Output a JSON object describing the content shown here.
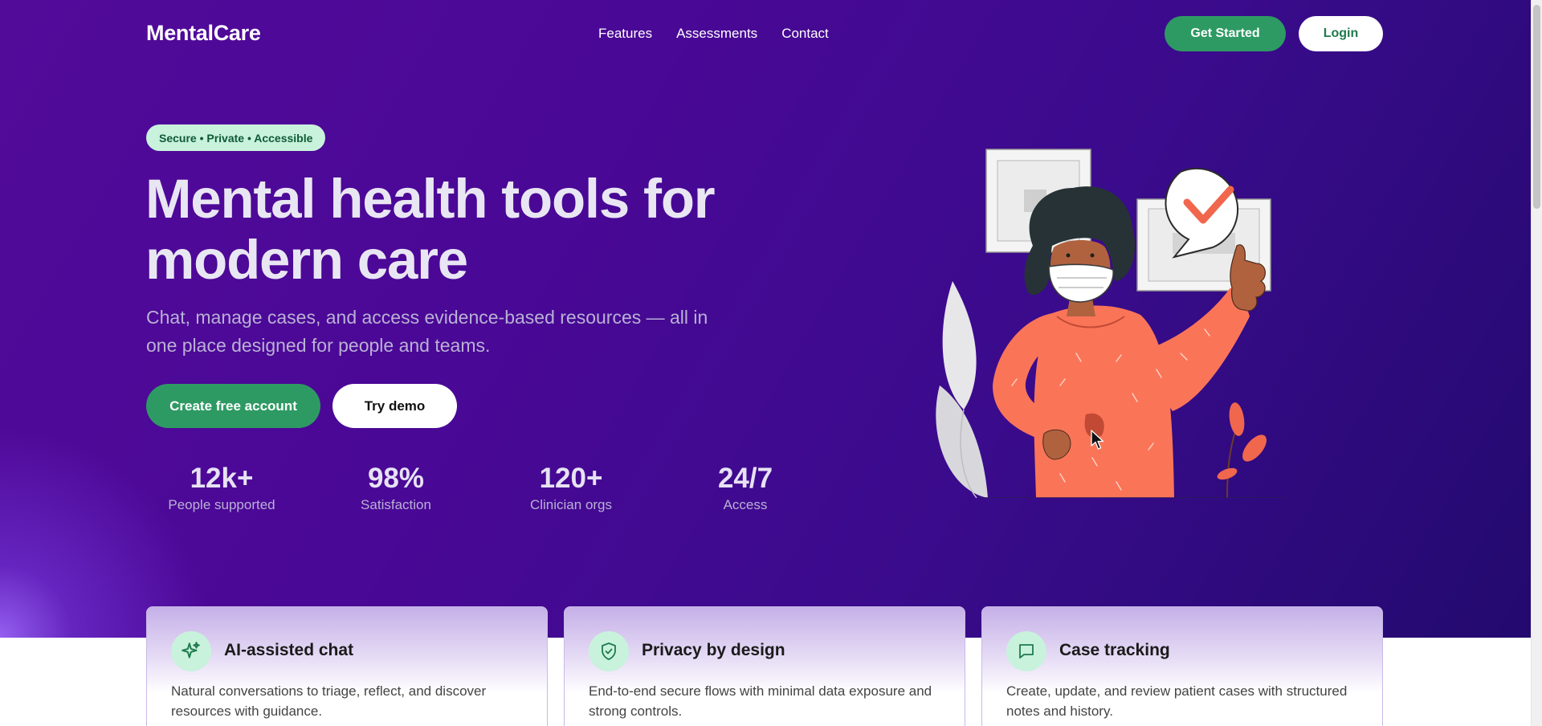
{
  "brand": {
    "name": "MentalCare"
  },
  "nav": {
    "items": [
      "Features",
      "Assessments",
      "Contact"
    ]
  },
  "header": {
    "get_started": "Get Started",
    "login": "Login"
  },
  "hero": {
    "badge": "Secure • Private • Accessible",
    "title": "Mental health tools for modern care",
    "subtitle": "Chat, manage cases, and access evidence-based resources — all in one place designed for people and teams.",
    "primary_cta": "Create free account",
    "secondary_cta": "Try demo"
  },
  "stats": [
    {
      "value": "12k+",
      "label": "People supported"
    },
    {
      "value": "98%",
      "label": "Satisfaction"
    },
    {
      "value": "120+",
      "label": "Clinician orgs"
    },
    {
      "value": "24/7",
      "label": "Access"
    }
  ],
  "features": [
    {
      "icon": "sparkle-icon",
      "title": "AI-assisted chat",
      "description": "Natural conversations to triage, reflect, and discover resources with guidance."
    },
    {
      "icon": "shield-check-icon",
      "title": "Privacy by design",
      "description": "End-to-end secure flows with minimal data exposure and strong controls."
    },
    {
      "icon": "chat-bubble-icon",
      "title": "Case tracking",
      "description": "Create, update, and review patient cases with structured notes and history."
    }
  ],
  "colors": {
    "primary_green": "#2e9a63",
    "hero_purple": "#4a0896",
    "badge_bg": "#c8f2dc",
    "illustration_coral": "#fa7558"
  }
}
